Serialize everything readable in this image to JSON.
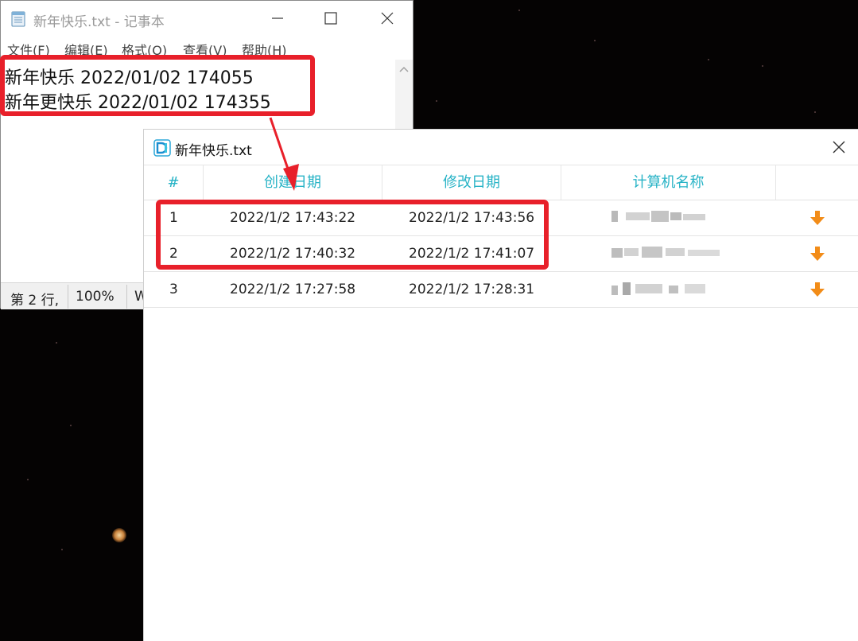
{
  "notepad": {
    "title": "新年快乐.txt - 记事本",
    "menu": [
      "文件(F)",
      "编辑(E)",
      "格式(O)",
      "查看(V)",
      "帮助(H)"
    ],
    "lines": [
      "新年快乐 2022/01/02 174055",
      "新年更快乐 2022/01/02 174355"
    ],
    "status": {
      "position": "第 2 行,",
      "zoom": "100%",
      "encoding_partial": "W"
    }
  },
  "dialog": {
    "title": "新年快乐.txt",
    "columns": [
      "#",
      "创建日期",
      "修改日期",
      "计算机名称"
    ],
    "rows": [
      {
        "num": "1",
        "created": "2022/1/2 17:43:22",
        "modified": "2022/1/2 17:43:56",
        "computer": ""
      },
      {
        "num": "2",
        "created": "2022/1/2 17:40:32",
        "modified": "2022/1/2 17:41:07",
        "computer": ""
      },
      {
        "num": "3",
        "created": "2022/1/2 17:27:58",
        "modified": "2022/1/2 17:28:31",
        "computer": ""
      }
    ],
    "download_icon": "download-arrow-icon",
    "accent_color": "#27b3c6",
    "download_color": "#f28c18"
  },
  "annotation": {
    "highlight_color": "#e8202a"
  }
}
